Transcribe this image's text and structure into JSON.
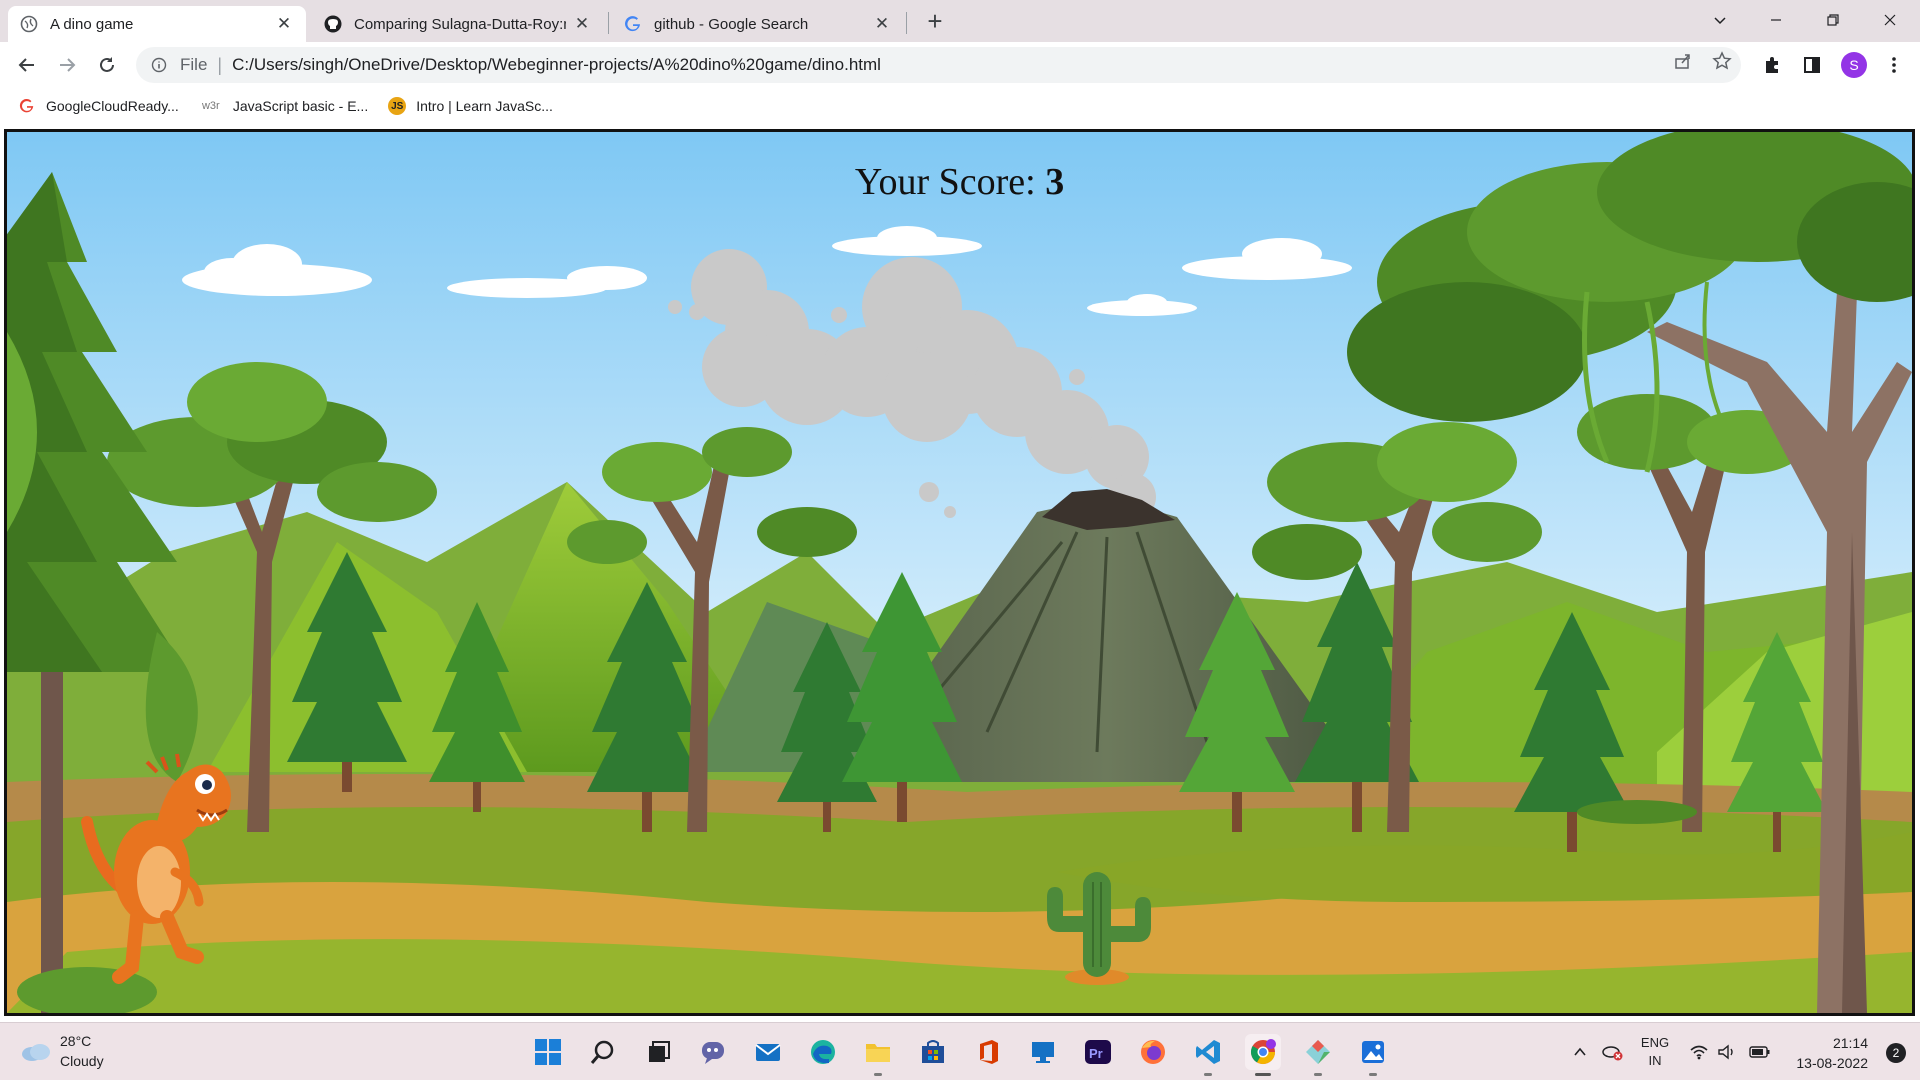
{
  "browser": {
    "tabs": [
      {
        "title": "A dino game",
        "active": true,
        "favicon": "globe-icon"
      },
      {
        "title": "Comparing Sulagna-Dutta-Roy:m",
        "active": false,
        "favicon": "github-icon"
      },
      {
        "title": "github - Google Search",
        "active": false,
        "favicon": "google-icon"
      }
    ],
    "address": {
      "scheme": "File",
      "url": "C:/Users/singh/OneDrive/Desktop/Webeginner-projects/A%20dino%20game/dino.html"
    },
    "profile_initial": "S",
    "bookmarks": [
      {
        "label": "GoogleCloudReady...",
        "icon": "google-icon"
      },
      {
        "label": "JavaScript basic - E...",
        "icon": "w3r-icon",
        "icon_text": "w3r"
      },
      {
        "label": "Intro | Learn JavaSc...",
        "icon": "js-icon",
        "icon_text": "JS"
      }
    ]
  },
  "game": {
    "score_label": "Your Score:",
    "score_value": "3"
  },
  "taskbar": {
    "weather_temp": "28°C",
    "weather_desc": "Cloudy",
    "lang_primary": "ENG",
    "lang_secondary": "IN",
    "time": "21:14",
    "date": "13-08-2022",
    "notification_count": "2",
    "colors": {
      "chrome_tab_bg": "#e6dfe3",
      "taskbar_bg": "#eee3e7",
      "profile": "#9334e6"
    }
  }
}
